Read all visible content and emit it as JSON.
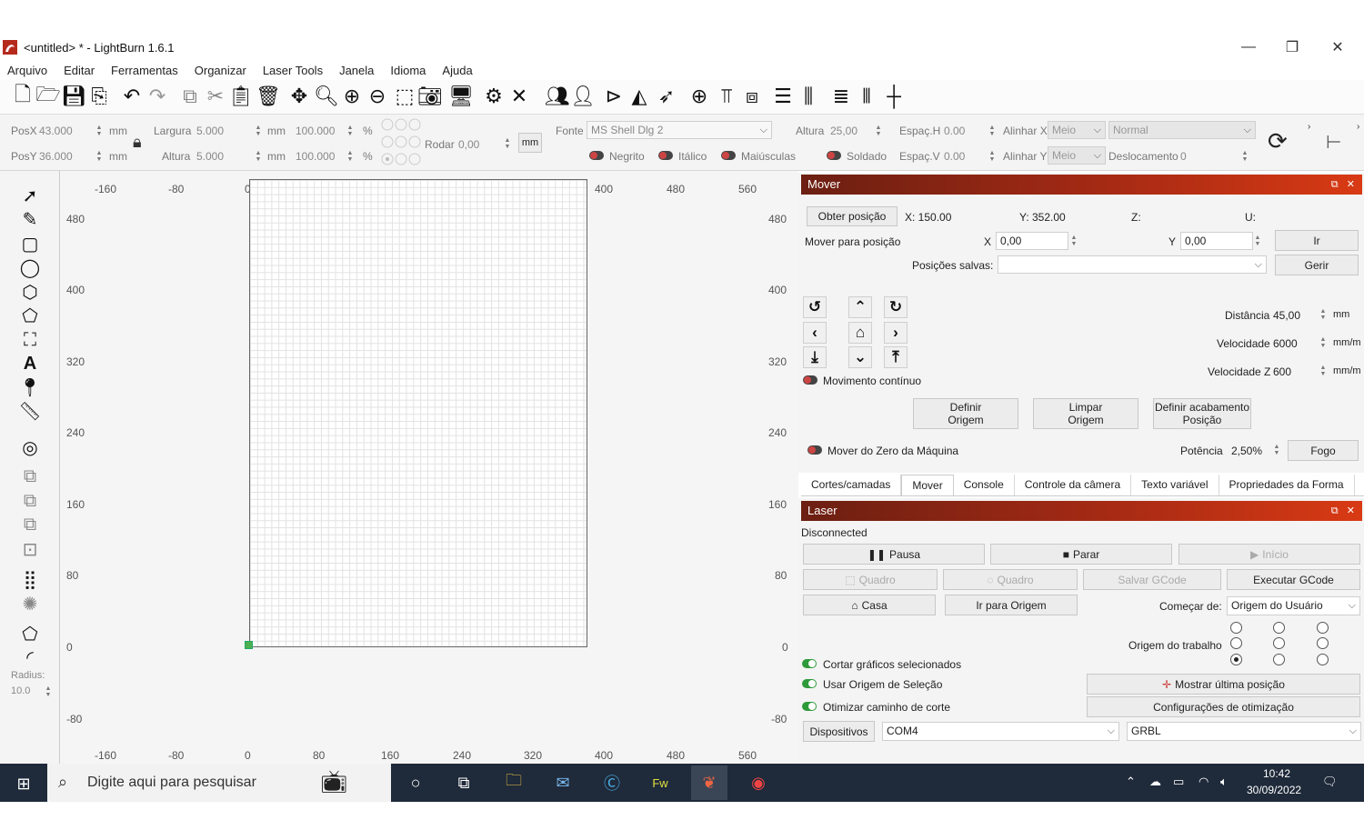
{
  "window": {
    "title": "<untitled> * - LightBurn 1.6.1",
    "minimize": "—",
    "restore": "❐",
    "close": "✕"
  },
  "menu": [
    "Arquivo",
    "Editar",
    "Ferramentas",
    "Organizar",
    "Laser Tools",
    "Janela",
    "Idioma",
    "Ajuda"
  ],
  "props": {
    "posx_label": "PosX",
    "posx": "43.000",
    "posy_label": "PosY",
    "posy": "36.000",
    "unit": "mm",
    "largura_label": "Largura",
    "largura": "5.000",
    "altura_label": "Altura",
    "altura": "5.000",
    "scale_w": "100.000",
    "scale_h": "100.000",
    "pct": "%",
    "rodar_label": "Rodar",
    "rodar": "0,00",
    "mm_btn": "mm",
    "fonte_label": "Fonte",
    "fonte": "MS Shell Dlg 2",
    "altura_font_label": "Altura",
    "altura_font": "25,00",
    "esph_label": "Espaç.H",
    "esph": "0.00",
    "espv_label": "Espaç.V",
    "espv": "0.00",
    "alinhx_label": "Alinhar X",
    "alinhx": "Meio",
    "alinhy_label": "Alinhar Y",
    "alinhy": "Meio",
    "normal": "Normal",
    "desloc_label": "Deslocamento",
    "desloc": "0",
    "negrito": "Negrito",
    "italico": "Itálico",
    "maiusculas": "Maiúsculas",
    "soldado": "Soldado"
  },
  "rulers": {
    "top": [
      "-160",
      "-80",
      "0",
      "80",
      "160",
      "240",
      "320",
      "400",
      "480",
      "560"
    ],
    "left": [
      "480",
      "400",
      "320",
      "240",
      "160",
      "80",
      "0",
      "-80"
    ]
  },
  "left_tools": {
    "radius_label": "Radius:",
    "radius": "10.0"
  },
  "mover": {
    "title": "Mover",
    "obter": "Obter posição",
    "x_pos": "X: 150.00",
    "y_pos": "Y: 352.00",
    "z_pos": "Z:",
    "u_pos": "U:",
    "mover_para": "Mover para posição",
    "x_label": "X",
    "x_val": "0,00",
    "y_label": "Y",
    "y_val": "0,00",
    "ir": "Ir",
    "posicoes": "Posições salvas:",
    "gerir": "Gerir",
    "distancia_label": "Distância",
    "distancia": "45,00",
    "dist_unit": "mm",
    "vel_label": "Velocidade",
    "vel": "6000",
    "vel_unit": "mm/m",
    "velz_label": "Velocidade Z",
    "velz": "600",
    "velz_unit": "mm/m",
    "continuo": "Movimento contínuo",
    "definir_origem": "Definir Origem",
    "limpar_origem": "Limpar Origem",
    "definir_acab": "Definir acabamento Posição",
    "mover_zero": "Mover do Zero da Máquina",
    "potencia_label": "Potência",
    "potencia": "2,50%",
    "fogo": "Fogo"
  },
  "tabs": [
    "Cortes/camadas",
    "Mover",
    "Console",
    "Controle da câmera",
    "Texto variável",
    "Propriedades da Forma"
  ],
  "laser": {
    "title": "Laser",
    "status": "Disconnected",
    "pausa": "Pausa",
    "parar": "Parar",
    "inicio": "Início",
    "quadro1": "Quadro",
    "quadro2": "Quadro",
    "salvar": "Salvar GCode",
    "executar": "Executar GCode",
    "casa": "Casa",
    "ir_origem": "Ir para Origem",
    "comecar_label": "Começar de:",
    "comecar": "Origem do Usuário",
    "origem_trabalho": "Origem do trabalho",
    "cortar": "Cortar gráficos selecionados",
    "usar_origem": "Usar Origem de Seleção",
    "otimizar": "Otimizar caminho de corte",
    "mostrar": "Mostrar última posição",
    "config_otim": "Configurações de otimização",
    "dispositivos": "Dispositivos",
    "porta": "COM4",
    "firmware": "GRBL"
  },
  "taskbar": {
    "search": "Digite aqui para pesquisar",
    "time": "10:42",
    "date": "30/09/2022"
  }
}
